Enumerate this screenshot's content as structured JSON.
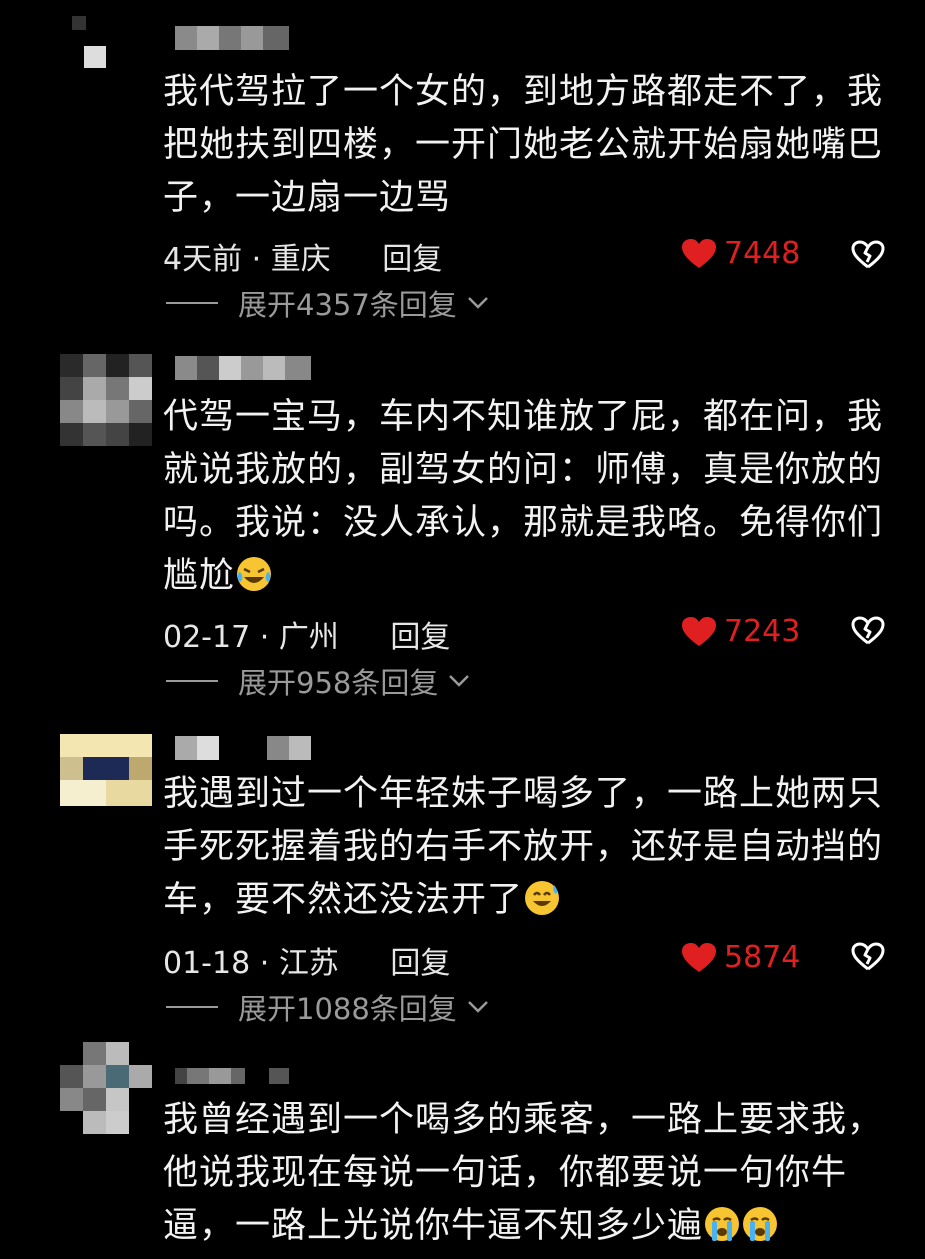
{
  "comments": [
    {
      "text": "我代驾拉了一个女的，到地方路都走不了，我把她扶到四楼，一开门她老公就开始扇她嘴巴子，一边扇一边骂",
      "emoji": "",
      "time": "4天前",
      "location": "重庆",
      "reply_label": "回复",
      "likes": "7448",
      "expand_label": "展开4357条回复"
    },
    {
      "text": "代驾一宝马，车内不知谁放了屁，都在问，我就说我放的，副驾女的问：师傅，真是你放的吗。我说：没人承认，那就是我咯。免得你们尴尬",
      "emoji": "laughing-tears",
      "time": "02-17",
      "location": "广州",
      "reply_label": "回复",
      "likes": "7243",
      "expand_label": "展开958条回复"
    },
    {
      "text": "我遇到过一个年轻妹子喝多了，一路上她两只手死死握着我的右手不放开，还好是自动挡的车，要不然还没法开了",
      "emoji": "sweat-smile",
      "time": "01-18",
      "location": "江苏",
      "reply_label": "回复",
      "likes": "5874",
      "expand_label": "展开1088条回复"
    },
    {
      "text": "我曾经遇到一个喝多的乘客，一路上要求我，他说我现在每说一句话，你都要说一句你牛逼，一路上光说你牛逼不知多少遍",
      "emoji": "crying-double"
    }
  ],
  "colors": {
    "like": "#e02020",
    "text": "#f2f2f2",
    "muted": "#9a9a9a",
    "background": "#000000"
  }
}
